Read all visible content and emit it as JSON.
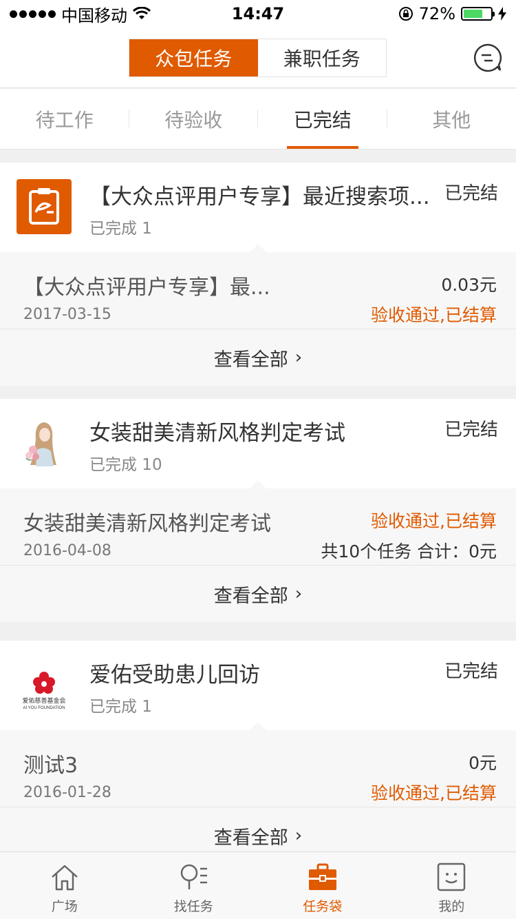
{
  "status": {
    "carrier": "中国移动",
    "time": "14:47",
    "battery": "72%",
    "battery_level": 0.72
  },
  "nav": {
    "segments": [
      {
        "label": "众包任务",
        "active": true
      },
      {
        "label": "兼职任务",
        "active": false
      }
    ],
    "message_icon": "chat-bubble-icon"
  },
  "tabs": [
    {
      "label": "待工作",
      "active": false
    },
    {
      "label": "待验收",
      "active": false
    },
    {
      "label": "已完结",
      "active": true
    },
    {
      "label": "其他",
      "active": false
    }
  ],
  "cards": [
    {
      "title": "【大众点评用户专享】最近搜索项...",
      "subtitle": "已完成 1",
      "status": "已完结",
      "logo": "clipboard-logo-icon",
      "item": {
        "title": "【大众点评用户专享】最...",
        "date": "2017-03-15",
        "right_top": "0.03元",
        "right_bottom": "验收通过,已结算"
      },
      "view_all": "查看全部"
    },
    {
      "title": "女装甜美清新风格判定考试",
      "subtitle": "已完成 10",
      "status": "已完结",
      "logo": "girl-illustration-icon",
      "item": {
        "title": "女装甜美清新风格判定考试",
        "date": "2016-04-08",
        "right_top": "验收通过,已结算",
        "right_bottom": "共10个任务 合计：0元"
      },
      "view_all": "查看全部"
    },
    {
      "title": "爱佑受助患儿回访",
      "subtitle": "已完成 1",
      "status": "已完结",
      "logo": "aiyou-foundation-logo",
      "logo_text_cn": "爱佑慈善基金会",
      "logo_text_en": "AI YOU FOUNDATION",
      "item": {
        "title": "测试3",
        "date": "2016-01-28",
        "right_top": "0元",
        "right_bottom": "验收通过,已结算"
      },
      "view_all": "查看全部"
    }
  ],
  "tabbar": [
    {
      "label": "广场",
      "icon": "house-icon",
      "active": false
    },
    {
      "label": "找任务",
      "icon": "search-list-icon",
      "active": false
    },
    {
      "label": "任务袋",
      "icon": "briefcase-icon",
      "active": true
    },
    {
      "label": "我的",
      "icon": "smiley-icon",
      "active": false
    }
  ],
  "colors": {
    "accent": "#e05a00",
    "battery": "#4cd964"
  }
}
